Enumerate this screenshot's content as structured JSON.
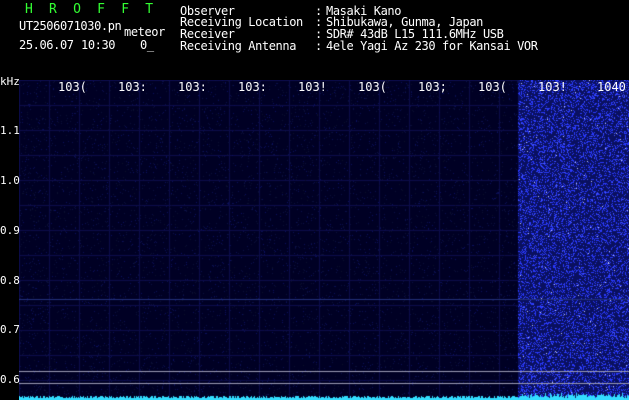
{
  "header": {
    "brand": "H R O F F T",
    "filename": "UT2506071030.pn",
    "category": "meteor",
    "date": "25.06.07",
    "time": "10:30",
    "count": "0_",
    "fields": [
      {
        "label": "Observer",
        "value": "Masaki Kano"
      },
      {
        "label": "Receiving Location",
        "value": "Shibukawa, Gunma, Japan"
      },
      {
        "label": "Receiver",
        "value": "SDR# 43dB L15 111.6MHz USB"
      },
      {
        "label": "Receiving Antenna",
        "value": "4ele Yagi Az 230 for Kansai VOR"
      }
    ],
    "separator": ":"
  },
  "spectrogram": {
    "y_unit": "kHz",
    "y_ticks": [
      "1.1",
      "1.0",
      "0.9",
      "0.8",
      "0.7",
      "0.6"
    ],
    "x_ticks": [
      "103(",
      "103:",
      "103:",
      "103:",
      "103!",
      "103(",
      "103;",
      "103(",
      "103!",
      "1040"
    ],
    "colors": {
      "background": "#000024",
      "grid": "#0c0c4a",
      "noise": "#2a3aff",
      "baseline": "#33ddff",
      "hline": "#9a9ab4"
    }
  }
}
